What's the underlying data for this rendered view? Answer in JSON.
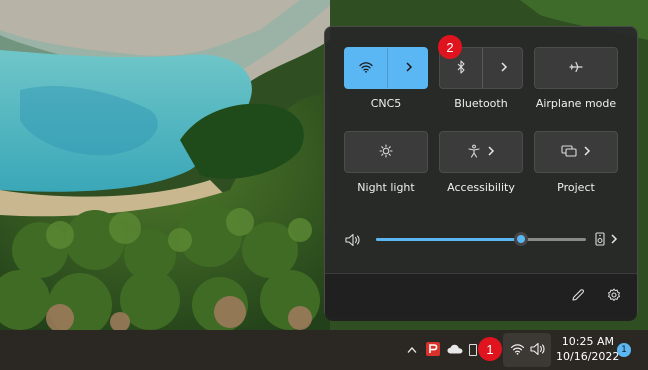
{
  "quick_settings": {
    "tiles": [
      {
        "id": "wifi",
        "label": "CNC5",
        "icon": "wifi-icon",
        "active": true,
        "has_arrow": true
      },
      {
        "id": "bluetooth",
        "label": "Bluetooth",
        "icon": "bluetooth-icon",
        "active": false,
        "has_arrow": true
      },
      {
        "id": "airplane",
        "label": "Airplane mode",
        "icon": "airplane-icon",
        "active": false,
        "has_arrow": false
      },
      {
        "id": "night_light",
        "label": "Night light",
        "icon": "night-light-icon",
        "active": false,
        "has_arrow": false
      },
      {
        "id": "accessibility",
        "label": "Accessibility",
        "icon": "accessibility-icon",
        "active": false,
        "has_arrow": true
      },
      {
        "id": "project",
        "label": "Project",
        "icon": "project-icon",
        "active": false,
        "has_arrow": true
      }
    ],
    "volume": {
      "level": 0.69
    },
    "footer": {
      "edit_icon": "pencil-icon",
      "settings_icon": "gear-icon"
    }
  },
  "annotations": {
    "step1": "1",
    "step2": "2"
  },
  "taskbar": {
    "tray_icons": [
      "chevron-up-icon",
      "app-icon",
      "onedrive-cloud-icon",
      "wifi-icon",
      "speaker-icon"
    ],
    "clock_time": "10:25 AM",
    "clock_date": "10/16/2022",
    "notification_count": "1"
  },
  "colors": {
    "accent": "#5bb7f3",
    "badge": "#e0141e",
    "taskbar": "#2b2723",
    "flyout": "#282828"
  }
}
